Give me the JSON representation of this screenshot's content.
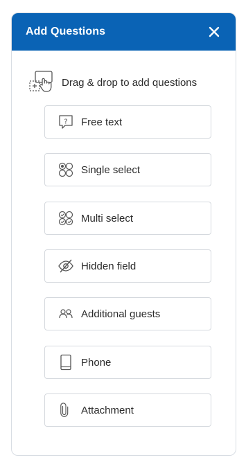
{
  "panel": {
    "title": "Add Questions",
    "close_symbol": "✕",
    "header_color": "#0a63b5"
  },
  "hint": {
    "icon": "drag-drop-icon",
    "text": "Drag & drop to add questions"
  },
  "question_types": [
    {
      "label": "Free text",
      "icon": "question-speech-icon"
    },
    {
      "label": "Single select",
      "icon": "radio-options-icon"
    },
    {
      "label": "Multi select",
      "icon": "check-options-icon"
    },
    {
      "label": "Hidden field",
      "icon": "eye-slash-icon"
    },
    {
      "label": "Additional guests",
      "icon": "people-icon"
    },
    {
      "label": "Phone",
      "icon": "phone-icon"
    },
    {
      "label": "Attachment",
      "icon": "paperclip-icon"
    }
  ]
}
